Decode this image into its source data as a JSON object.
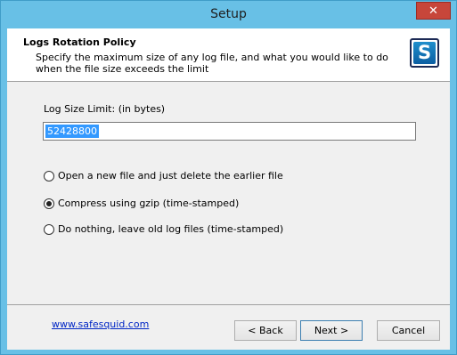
{
  "window": {
    "title": "Setup",
    "close_glyph": "✕"
  },
  "header": {
    "title": "Logs Rotation Policy",
    "description": "Specify the maximum size of any log file, and what you would like to do when the file size exceeds the limit",
    "logo_letter": "S"
  },
  "form": {
    "size_label": "Log Size Limit: (in bytes)",
    "size_value": "52428800",
    "options": [
      {
        "label": "Open a new file and just delete the earlier file",
        "selected": false
      },
      {
        "label": "Compress using gzip (time-stamped)",
        "selected": true
      },
      {
        "label": "Do nothing, leave old log files (time-stamped)",
        "selected": false
      }
    ]
  },
  "footer": {
    "link": "www.safesquid.com",
    "back_label": "< Back",
    "next_label": "Next >",
    "cancel_label": "Cancel"
  }
}
